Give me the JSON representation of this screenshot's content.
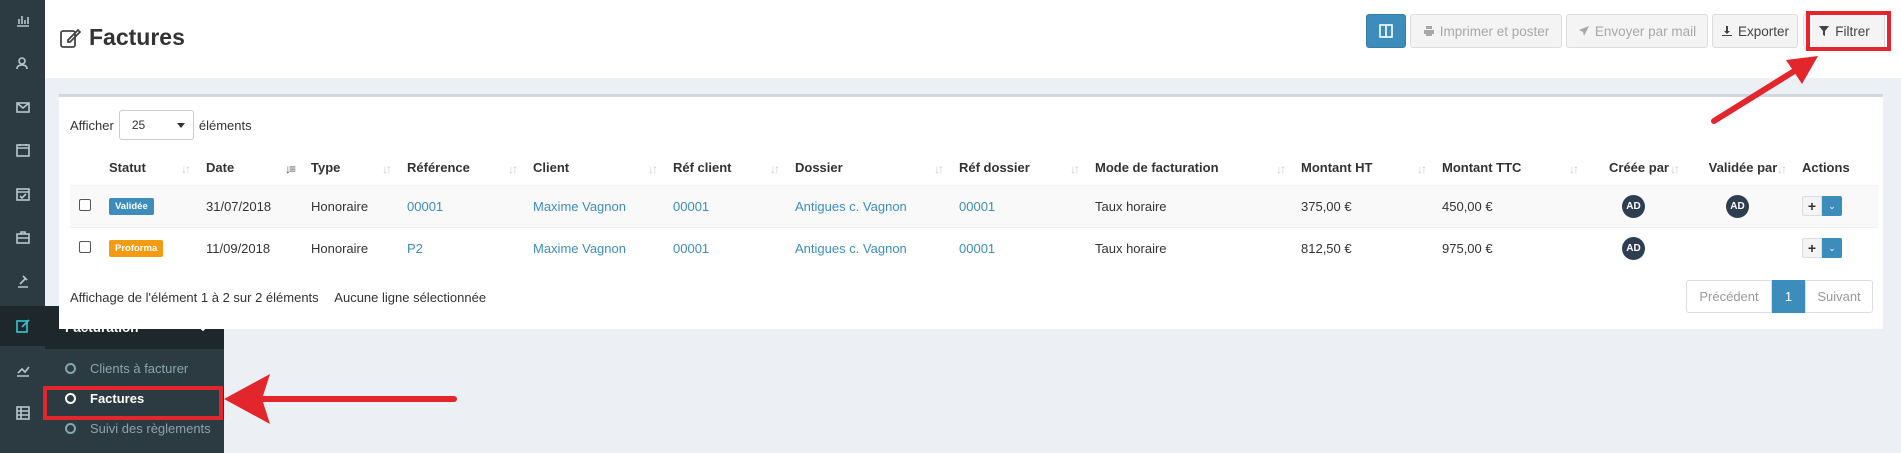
{
  "header": {
    "title": "Factures",
    "buttons": {
      "columns_icon": "columns-icon",
      "print_label": "Imprimer et poster",
      "mail_label": "Envoyer par mail",
      "export_label": "Exporter",
      "filter_label": "Filtrer"
    }
  },
  "sidebar": {
    "icons": [
      "chart-icon",
      "users-icon",
      "mail-icon",
      "calendar-icon",
      "calendar-check-icon",
      "briefcase-icon",
      "gavel-icon",
      "edit-icon",
      "trend-icon",
      "table-icon"
    ],
    "flyout": {
      "title": "Facturation",
      "items": [
        {
          "label": "Clients à facturer"
        },
        {
          "label": "Factures"
        },
        {
          "label": "Suivi des règlements"
        }
      ]
    }
  },
  "table": {
    "show_label": "Afficher",
    "page_size": "25",
    "elements_label": "éléments",
    "columns": [
      "Statut",
      "Date",
      "Type",
      "Référence",
      "Client",
      "Réf client",
      "Dossier",
      "Réf dossier",
      "Mode de facturation",
      "Montant HT",
      "Montant TTC",
      "Créée par",
      "Validée par",
      "Actions"
    ],
    "rows": [
      {
        "status": "Validée",
        "status_color": "#3c8dbc",
        "date": "31/07/2018",
        "type": "Honoraire",
        "reference": "00001",
        "client": "Maxime Vagnon",
        "ref_client": "00001",
        "dossier": "Antigues c. Vagnon",
        "ref_dossier": "00001",
        "mode": "Taux horaire",
        "ht": "375,00 €",
        "ttc": "450,00 €",
        "created_by": "AD",
        "validated_by": "AD"
      },
      {
        "status": "Proforma",
        "status_color": "#f39c12",
        "date": "11/09/2018",
        "type": "Honoraire",
        "reference": "P2",
        "client": "Maxime Vagnon",
        "ref_client": "00001",
        "dossier": "Antigues c. Vagnon",
        "ref_dossier": "00001",
        "mode": "Taux horaire",
        "ht": "812,50 €",
        "ttc": "975,00 €",
        "created_by": "AD",
        "validated_by": ""
      }
    ],
    "info": "Affichage de l'élément 1 à 2 sur 2 éléments",
    "selection": "Aucune ligne sélectionnée",
    "pager": {
      "prev": "Précédent",
      "current": "1",
      "next": "Suivant"
    }
  },
  "colors": {
    "accent": "#3c8dbc",
    "highlight": "#e3262c",
    "sidebar": "#2c3b41"
  }
}
